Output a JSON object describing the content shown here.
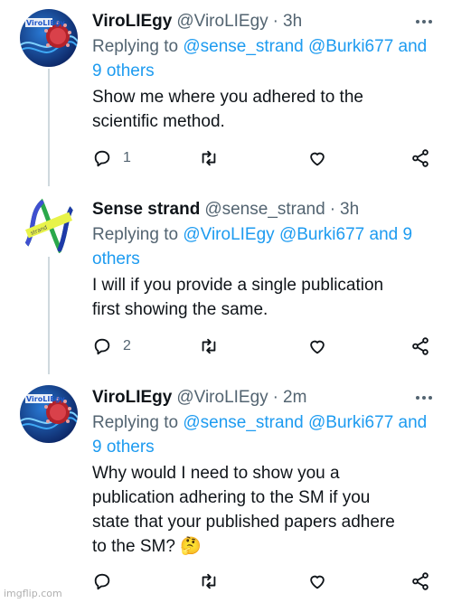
{
  "tweets": [
    {
      "name": "ViroLIEgy",
      "handle": "@ViroLIEgy",
      "dot": "·",
      "time": "3h",
      "replying_prefix": "Replying to",
      "replying_line1_links": "@sense_strand @Burki677 and",
      "replying_line2": "9 others",
      "text_lines": [
        "Show me where you adhered to the",
        "scientific method."
      ],
      "reply_count": "1"
    },
    {
      "name": "Sense strand",
      "handle": "@sense_strand",
      "dot": "·",
      "time": "3h",
      "replying_prefix": "Replying to",
      "replying_line1_links": "@ViroLIEgy @Burki677 and 9",
      "replying_line2": "others",
      "text_lines": [
        "I will if you provide a single publication",
        "first showing the same."
      ],
      "reply_count": "2"
    },
    {
      "name": "ViroLIEgy",
      "handle": "@ViroLIEgy",
      "dot": "·",
      "time": "2m",
      "replying_prefix": "Replying to",
      "replying_line1_links": "@sense_strand @Burki677 and",
      "replying_line2": "9 others",
      "text_lines": [
        "Why would I need to show you a",
        "publication adhering to the SM if you",
        "state that your published papers adhere",
        "to the SM? 🤔"
      ],
      "reply_count": ""
    }
  ],
  "icons": {
    "reply": "reply-icon",
    "retweet": "retweet-icon",
    "like": "heart-icon",
    "share": "share-icon",
    "more": "more-options-icon"
  },
  "colors": {
    "link": "#1d9bf0",
    "secondary_text": "#536471",
    "primary_text": "#0f1419",
    "thread_line": "#cfd9de"
  },
  "watermark": "imgflip.com"
}
